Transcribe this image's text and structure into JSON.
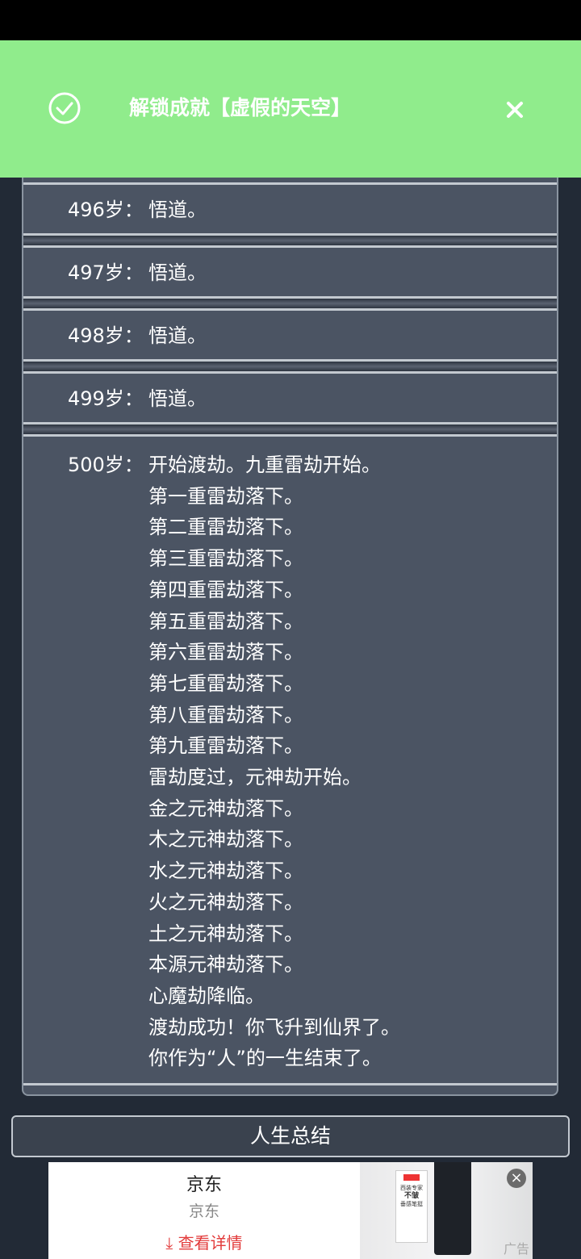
{
  "notification": {
    "title": "解锁成就【虚假的天空】",
    "check_icon": "check-circle-icon",
    "close_icon": "close-icon",
    "background": "#90ec8c"
  },
  "log": {
    "entries": [
      {
        "age": "496岁：",
        "lines": [
          "悟道。"
        ]
      },
      {
        "age": "497岁：",
        "lines": [
          "悟道。"
        ]
      },
      {
        "age": "498岁：",
        "lines": [
          "悟道。"
        ]
      },
      {
        "age": "499岁：",
        "lines": [
          "悟道。"
        ]
      },
      {
        "age": "500岁：",
        "lines": [
          "开始渡劫。九重雷劫开始。",
          "第一重雷劫落下。",
          "第二重雷劫落下。",
          "第三重雷劫落下。",
          "第四重雷劫落下。",
          "第五重雷劫落下。",
          "第六重雷劫落下。",
          "第七重雷劫落下。",
          "第八重雷劫落下。",
          "第九重雷劫落下。",
          "雷劫度过，元神劫开始。",
          "金之元神劫落下。",
          "木之元神劫落下。",
          "水之元神劫落下。",
          "火之元神劫落下。",
          "土之元神劫落下。",
          "本源元神劫落下。",
          "心魔劫降临。",
          "渡劫成功！你飞升到仙界了。",
          "你作为“人”的一生结束了。"
        ]
      }
    ]
  },
  "summary_button": {
    "label": "人生总结"
  },
  "ad": {
    "brand": "京东",
    "subtitle": "京东",
    "cta": "查看详情",
    "cta_icon": "download-arrow-icon",
    "close_icon": "close-icon",
    "label": "广告",
    "tag_lines": [
      "西装专家",
      "不皱",
      "垂感笔挺"
    ]
  }
}
